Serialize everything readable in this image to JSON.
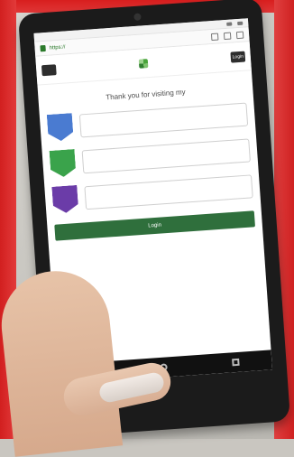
{
  "browser": {
    "tab_title": "",
    "url": "https://"
  },
  "page": {
    "login_top": "Login",
    "welcome_prefix": "Thank you for visiting my",
    "welcome_brand": "",
    "steps": [
      {
        "badge": "",
        "line1": "",
        "line2": ""
      },
      {
        "badge": "",
        "line1": "",
        "line2": ""
      },
      {
        "badge": "",
        "line1": "",
        "line2": ""
      }
    ],
    "login_button": "Login",
    "footer": {
      "left": "",
      "center": "",
      "right": ""
    }
  },
  "colors": {
    "background_red": "#d21f1f",
    "tablet_bezel": "#1b1b1b",
    "brand_green": "#2f7f2f",
    "step_blue": "#4a7bd1",
    "step_green": "#3aa34b",
    "step_purple": "#6b3ca8"
  },
  "icons": [
    "lock-icon",
    "menu-icon",
    "logo-icon",
    "back-icon",
    "home-icon",
    "recent-apps-icon"
  ]
}
